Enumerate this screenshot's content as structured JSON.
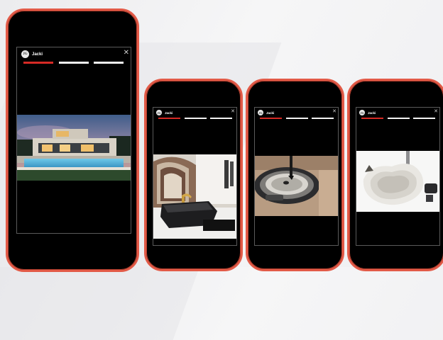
{
  "brand": {
    "name": "Jacki",
    "logo_letter": "JG"
  },
  "close_icon": "close-icon",
  "colors": {
    "frame": "#e25a47",
    "active_bar": "#d62a25",
    "bar": "#f2f2f2"
  },
  "phones": [
    {
      "progress": [
        1,
        0,
        0
      ],
      "photo": "modern villa exterior at dusk with infinity pool"
    },
    {
      "progress": [
        1,
        0,
        0
      ],
      "photo": "bathroom with faceted black bathtub and gold faucet"
    },
    {
      "progress": [
        1,
        0,
        0
      ],
      "photo": "round sink basin with black faucet, top view"
    },
    {
      "progress": [
        1,
        0,
        0
      ],
      "photo": "white sculpted washbasin with dark faucet"
    }
  ]
}
